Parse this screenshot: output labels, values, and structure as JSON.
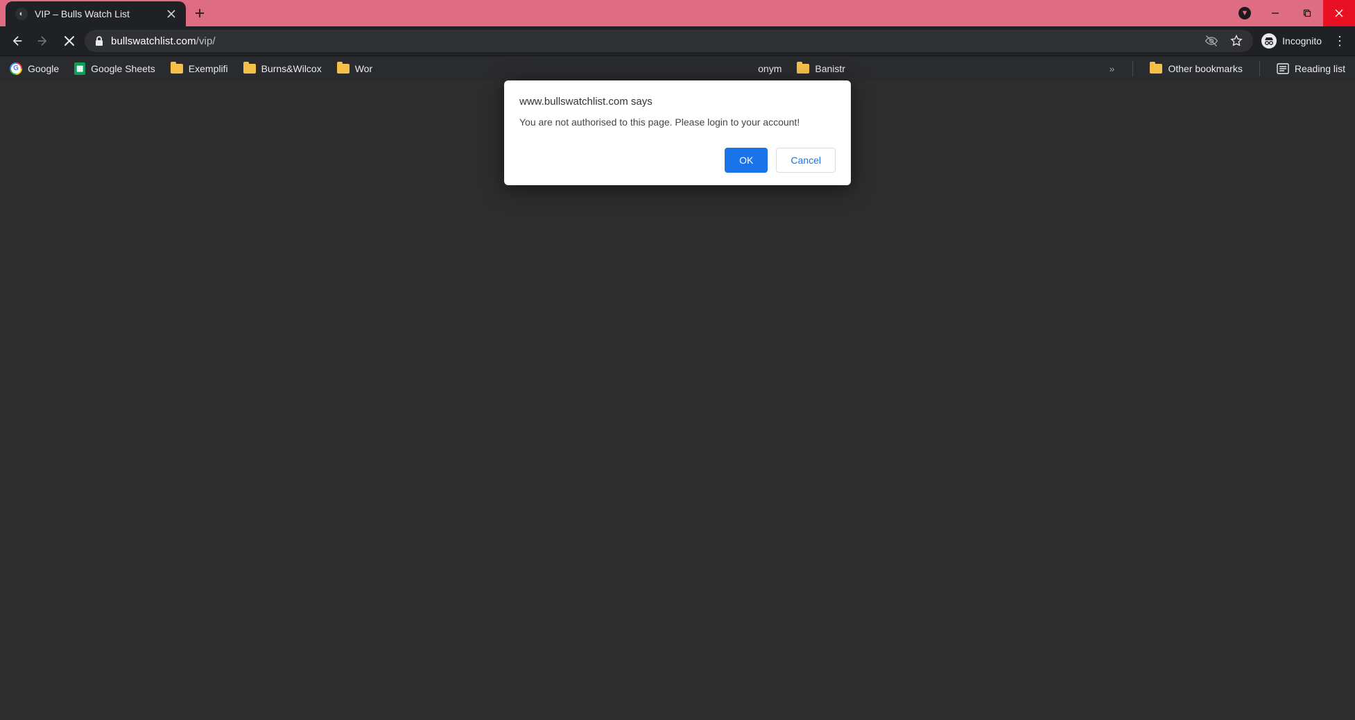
{
  "tab": {
    "title": "VIP – Bulls Watch List"
  },
  "url": {
    "domain": "bullswatchlist.com",
    "path": "/vip/"
  },
  "toolbar": {
    "incognito_label": "Incognito"
  },
  "bookmarks": {
    "items": [
      {
        "label": "Google"
      },
      {
        "label": "Google Sheets"
      },
      {
        "label": "Exemplifi"
      },
      {
        "label": "Burns&Wilcox"
      },
      {
        "label": "Wor"
      },
      {
        "label": "onym"
      },
      {
        "label": "Banistr"
      }
    ],
    "other_label": "Other bookmarks",
    "reading_list_label": "Reading list"
  },
  "dialog": {
    "title": "www.bullswatchlist.com says",
    "message": "You are not authorised to this page. Please login to your account!",
    "ok_label": "OK",
    "cancel_label": "Cancel"
  }
}
